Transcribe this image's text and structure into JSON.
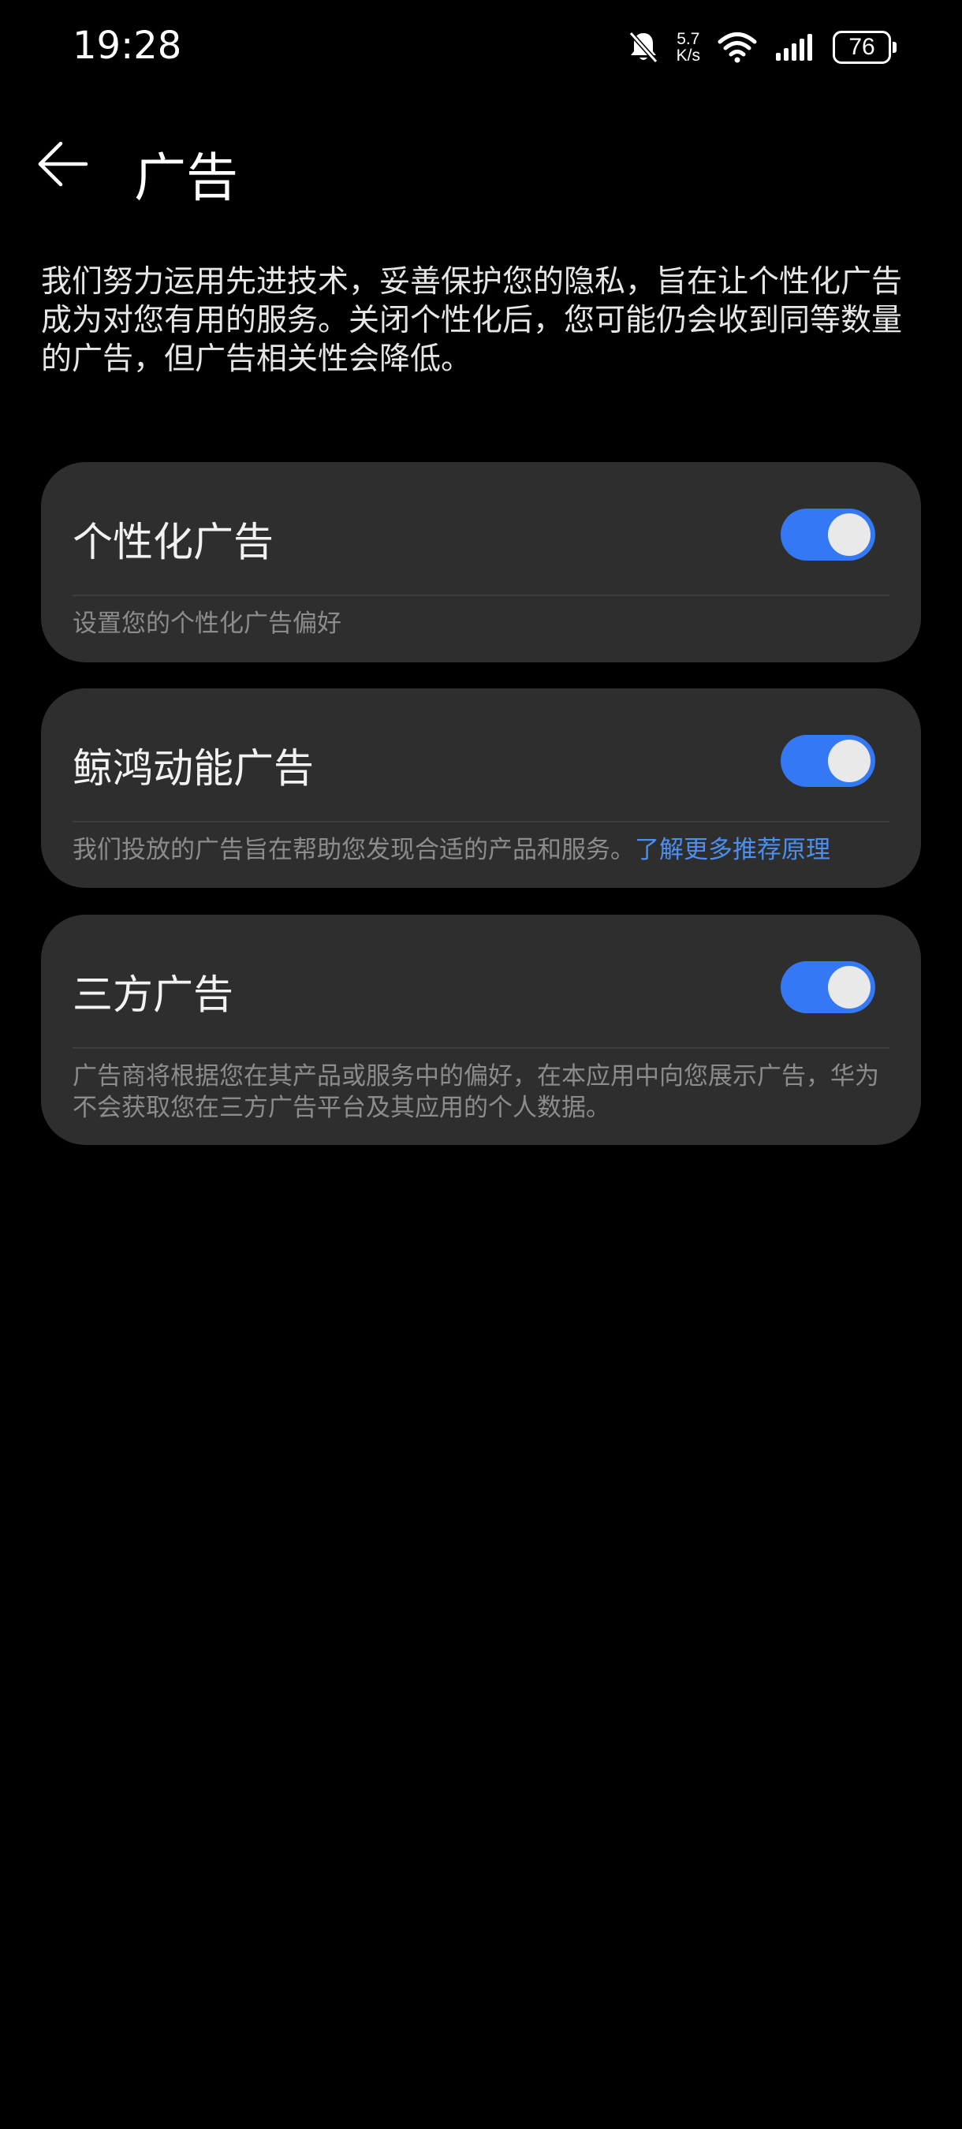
{
  "status_bar": {
    "time": "19:28",
    "net_speed_value": "5.7",
    "net_speed_unit": "K/s",
    "battery": "76",
    "icons": [
      "bell-muted-icon",
      "wifi-icon",
      "signal-icon",
      "battery-icon"
    ]
  },
  "header": {
    "title": "广告",
    "back_icon": "back-arrow-icon"
  },
  "intro": "我们努力运用先进技术，妥善保护您的隐私，旨在让个性化广告成为对您有用的服务。关闭个性化后，您可能仍会收到同等数量的广告，但广告相关性会降低。",
  "cards": [
    {
      "title": "个性化广告",
      "enabled": true,
      "description": "设置您的个性化广告偏好"
    },
    {
      "title": "鲸鸿动能广告",
      "enabled": true,
      "description": "我们投放的广告旨在帮助您发现合适的产品和服务。",
      "link": "了解更多推荐原理"
    },
    {
      "title": "三方广告",
      "enabled": true,
      "description": "广告商将根据您在其产品或服务中的偏好，在本应用中向您展示广告，华为不会获取您在三方广告平台及其应用的个人数据。"
    }
  ],
  "colors": {
    "background": "#000000",
    "card": "#2e2e2e",
    "toggle_on": "#3478f6",
    "link": "#4b8ff0",
    "secondary_text": "#8c8c8c"
  }
}
